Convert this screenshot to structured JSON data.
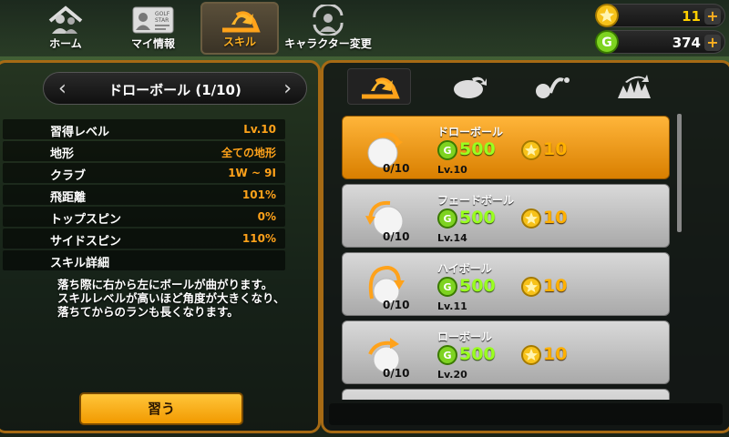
{
  "nav": {
    "home": "ホーム",
    "my_info": "マイ情報",
    "skill": "スキル",
    "character_change": "キャラクター変更"
  },
  "currency": {
    "star_value": "11",
    "gold_value": "374",
    "star_color": "#ffd000",
    "gold_color": "#7ed321"
  },
  "skill_header": {
    "title": "ドローボール (1/10)"
  },
  "stats": [
    {
      "label": "習得レベル",
      "value": "Lv.10"
    },
    {
      "label": "地形",
      "value": "全ての地形"
    },
    {
      "label": "クラブ",
      "value": "1W ~ 9I"
    },
    {
      "label": "飛距離",
      "value": "101%"
    },
    {
      "label": "トップスピン",
      "value": "0%"
    },
    {
      "label": "サイドスピン",
      "value": "110%"
    },
    {
      "label": "スキル詳細",
      "value": ""
    }
  ],
  "description": {
    "line1": "落ち際に右から左にボールが曲がります。",
    "line2": "スキルレベルが高いほど角度が大きくなり、",
    "line3": "落ちてからのランも長くなります。"
  },
  "learn_button": "習う",
  "skill_list": [
    {
      "name": "ドローボール",
      "count": "0/10",
      "gold_price": "500",
      "star_price": "10",
      "level": "Lv.10",
      "selected": true
    },
    {
      "name": "フェードボール",
      "count": "0/10",
      "gold_price": "500",
      "star_price": "10",
      "level": "Lv.14",
      "selected": false
    },
    {
      "name": "ハイボール",
      "count": "0/10",
      "gold_price": "500",
      "star_price": "10",
      "level": "Lv.11",
      "selected": false
    },
    {
      "name": "ローボール",
      "count": "0/10",
      "gold_price": "500",
      "star_price": "10",
      "level": "Lv.20",
      "selected": false
    }
  ],
  "colors": {
    "accent": "#ffa21a",
    "panel_border": "#a66a14",
    "selected_card": "#f29a00"
  }
}
